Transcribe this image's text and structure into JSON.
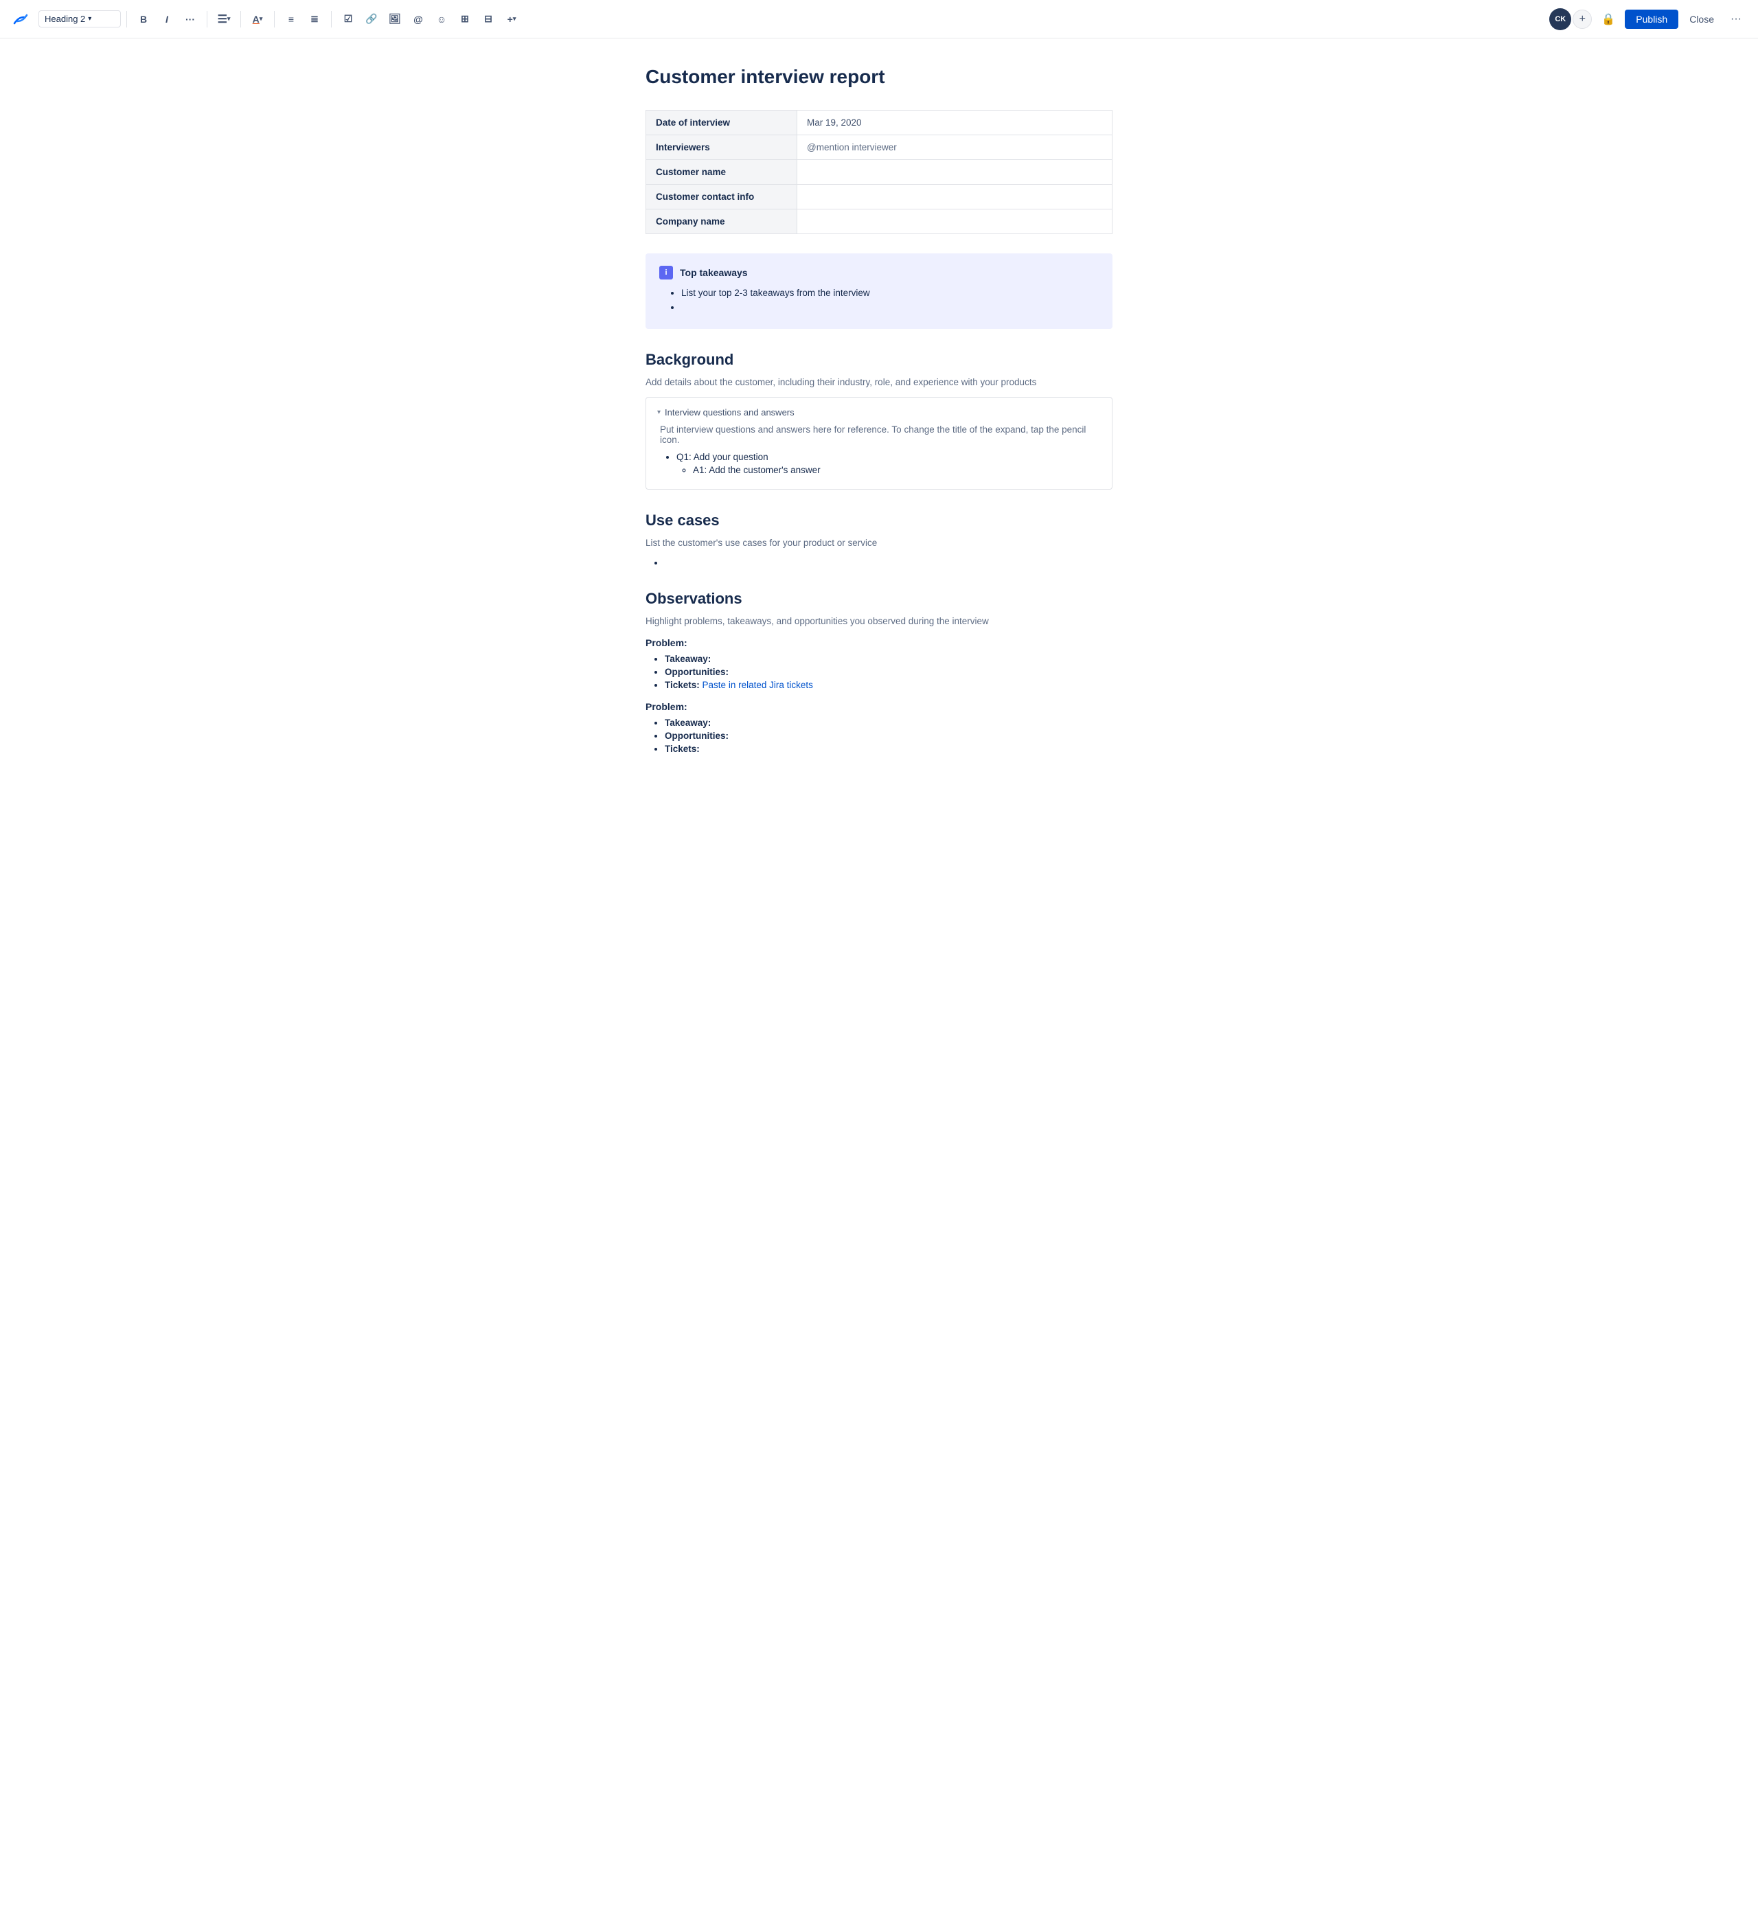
{
  "toolbar": {
    "logo_label": "Confluence",
    "heading_select": "Heading 2",
    "chevron": "▾",
    "bold": "B",
    "italic": "I",
    "more_text": "···",
    "align_icon": "≡",
    "align_chevron": "▾",
    "text_color_icon": "A",
    "unordered_list": "≡",
    "ordered_list": "≡",
    "task_list": "✓",
    "link": "🔗",
    "image": "🖼",
    "mention": "@",
    "emoji": "☺",
    "table": "⊞",
    "layout": "⊟",
    "more_plus": "+▾",
    "avatar_initials": "CK",
    "avatar_add": "+",
    "lock_icon": "🔒",
    "publish_label": "Publish",
    "close_label": "Close",
    "more_options": "···"
  },
  "page": {
    "title": "Customer interview report"
  },
  "info_table": {
    "rows": [
      {
        "label": "Date of interview",
        "value": "Mar 19, 2020"
      },
      {
        "label": "Interviewers",
        "value": "@mention interviewer"
      },
      {
        "label": "Customer name",
        "value": ""
      },
      {
        "label": "Customer contact info",
        "value": ""
      },
      {
        "label": "Company name",
        "value": ""
      }
    ]
  },
  "callout": {
    "icon_label": "i",
    "title": "Top takeaways",
    "items": [
      "List your top 2-3 takeaways from the interview",
      ""
    ]
  },
  "background_section": {
    "heading": "Background",
    "description": "Add details about the customer, including their industry, role, and experience with your products",
    "expand_title": "Interview questions and answers",
    "expand_body": "Put interview questions and answers here for reference. To change the title of the expand, tap the pencil icon.",
    "questions": [
      {
        "question": "Q1: Add your question",
        "answers": [
          "A1: Add the customer's answer"
        ]
      }
    ]
  },
  "use_cases_section": {
    "heading": "Use cases",
    "description": "List the customer's use cases for your product or service",
    "items": [
      ""
    ]
  },
  "observations_section": {
    "heading": "Observations",
    "description": "Highlight problems, takeaways, and opportunities you observed during the interview",
    "problems": [
      {
        "label": "Problem:",
        "bullets": [
          {
            "prefix": "Takeaway:",
            "text": ""
          },
          {
            "prefix": "Opportunities:",
            "text": ""
          },
          {
            "prefix": "Tickets:",
            "text": "Paste in related Jira tickets",
            "is_link": true
          }
        ]
      },
      {
        "label": "Problem:",
        "bullets": [
          {
            "prefix": "Takeaway:",
            "text": ""
          },
          {
            "prefix": "Opportunities:",
            "text": ""
          },
          {
            "prefix": "Tickets:",
            "text": ""
          }
        ]
      }
    ]
  }
}
